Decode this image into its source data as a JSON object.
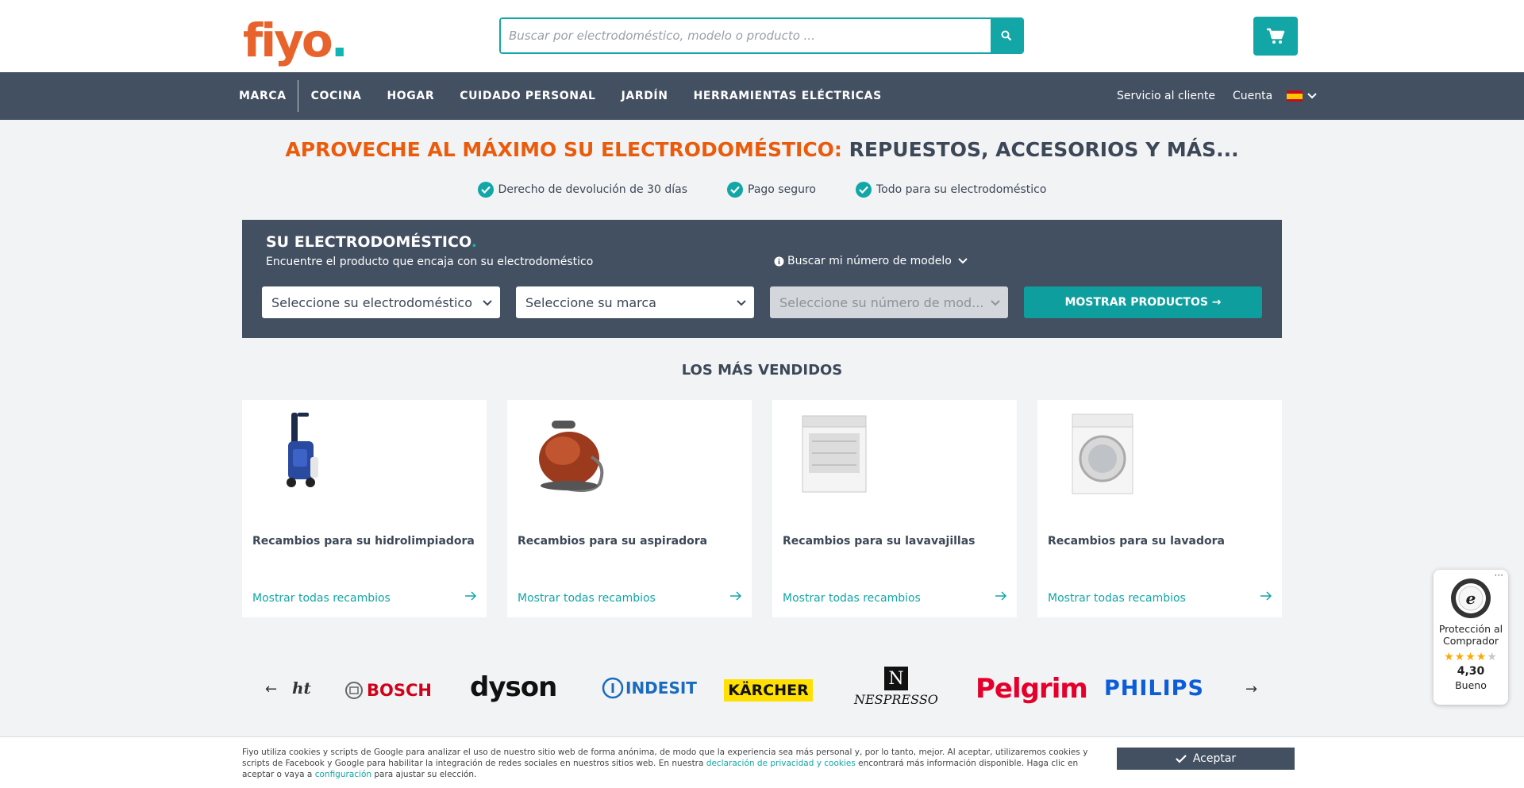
{
  "header": {
    "logo_text": "fiyo",
    "logo_dot": ".",
    "search_placeholder": "Buscar por electrodoméstico, modelo o producto ...",
    "search_icon": "search-icon",
    "cart_icon": "cart-icon"
  },
  "nav": {
    "items": [
      "MARCA",
      "COCINA",
      "HOGAR",
      "CUIDADO PERSONAL",
      "JARDÍN",
      "HERRAMIENTAS ELÉCTRICAS"
    ],
    "customer_service": "Servicio al cliente",
    "account": "Cuenta",
    "language_flag": "spain-flag-icon"
  },
  "hero": {
    "headline_highlight": "APROVECHE AL MÁXIMO SU ELECTRODOMÉSTICO:",
    "headline_rest": " REPUESTOS, ACCESORIOS Y MÁS...",
    "usps": [
      "Derecho de devolución de 30 días",
      "Pago seguro",
      "Todo para su electrodoméstico"
    ]
  },
  "finder": {
    "title": "SU ELECTRODOMÉSTICO",
    "title_dot": ".",
    "subtitle": "Encuentre el producto que encaja con su electrodoméstico",
    "model_help": "Buscar mi número de modelo",
    "select_appliance": "Seleccione su electrodoméstico",
    "select_brand": "Seleccione su marca",
    "select_model": "Seleccione su número de mod...",
    "show_button": "MOSTRAR PRODUCTOS →"
  },
  "bestsellers": {
    "title": "LOS MÁS VENDIDOS",
    "cards": [
      {
        "title": "Recambios para su hidrolimpiadora",
        "link": "Mostrar todas recambios",
        "image": "pressure-washer-image"
      },
      {
        "title": "Recambios para su aspiradora",
        "link": "Mostrar todas recambios",
        "image": "vacuum-cleaner-image"
      },
      {
        "title": "Recambios para su lavavajillas",
        "link": "Mostrar todas recambios",
        "image": "dishwasher-image"
      },
      {
        "title": "Recambios para su lavadora",
        "link": "Mostrar todas recambios",
        "image": "washing-machine-image"
      }
    ]
  },
  "brands": {
    "prev": "←",
    "next": "→",
    "list": [
      "ht",
      "BOSCH",
      "dyson",
      "INDESIT",
      "KÄRCHER",
      "NESPRESSO",
      "Pelgrim",
      "PHILIPS"
    ]
  },
  "trust": {
    "menu": "···",
    "label": "Protección al Comprador",
    "stars": "★★★★★",
    "score": "4,30",
    "rating": "Bueno"
  },
  "cookie": {
    "text1": "Fiyo utiliza cookies y scripts de Google para analizar el uso de nuestro sitio web de forma anónima, de modo que la experiencia sea más personal y, por lo tanto, mejor. Al aceptar, utilizaremos cookies y scripts de Facebook y Google para habilitar la integración de redes sociales en nuestros sitios web. En nuestra ",
    "link1": "declaración de privacidad y cookies",
    "text2": " encontrará más información disponible. Haga clic en aceptar o vaya a ",
    "link2": "configuración",
    "text3": " para ajustar su elección.",
    "accept": "Aceptar"
  },
  "colors": {
    "teal": "#12a6a6",
    "navy": "#435061",
    "orange": "#ea5b0c"
  }
}
